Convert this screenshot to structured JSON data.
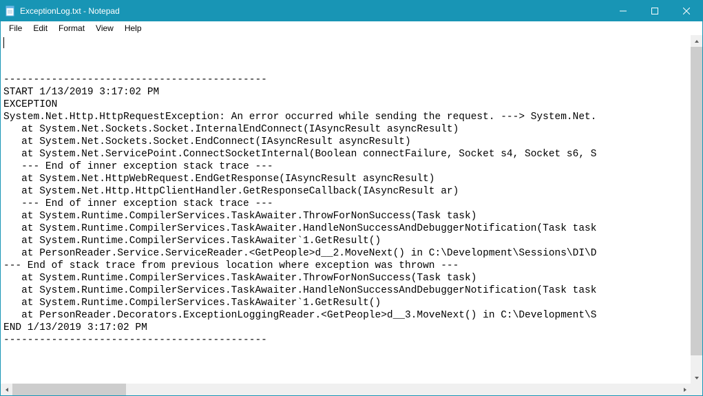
{
  "window": {
    "title": "ExceptionLog.txt - Notepad"
  },
  "menu": {
    "file": "File",
    "edit": "Edit",
    "format": "Format",
    "view": "View",
    "help": "Help"
  },
  "content": {
    "lines": [
      "--------------------------------------------",
      "START 1/13/2019 3:17:02 PM",
      "EXCEPTION",
      "System.Net.Http.HttpRequestException: An error occurred while sending the request. ---> System.Net.",
      "   at System.Net.Sockets.Socket.InternalEndConnect(IAsyncResult asyncResult)",
      "   at System.Net.Sockets.Socket.EndConnect(IAsyncResult asyncResult)",
      "   at System.Net.ServicePoint.ConnectSocketInternal(Boolean connectFailure, Socket s4, Socket s6, S",
      "   --- End of inner exception stack trace ---",
      "   at System.Net.HttpWebRequest.EndGetResponse(IAsyncResult asyncResult)",
      "   at System.Net.Http.HttpClientHandler.GetResponseCallback(IAsyncResult ar)",
      "   --- End of inner exception stack trace ---",
      "   at System.Runtime.CompilerServices.TaskAwaiter.ThrowForNonSuccess(Task task)",
      "   at System.Runtime.CompilerServices.TaskAwaiter.HandleNonSuccessAndDebuggerNotification(Task task",
      "   at System.Runtime.CompilerServices.TaskAwaiter`1.GetResult()",
      "   at PersonReader.Service.ServiceReader.<GetPeople>d__2.MoveNext() in C:\\Development\\Sessions\\DI\\D",
      "--- End of stack trace from previous location where exception was thrown ---",
      "   at System.Runtime.CompilerServices.TaskAwaiter.ThrowForNonSuccess(Task task)",
      "   at System.Runtime.CompilerServices.TaskAwaiter.HandleNonSuccessAndDebuggerNotification(Task task",
      "   at System.Runtime.CompilerServices.TaskAwaiter`1.GetResult()",
      "   at PersonReader.Decorators.ExceptionLoggingReader.<GetPeople>d__3.MoveNext() in C:\\Development\\S",
      "END 1/13/2019 3:17:02 PM",
      "--------------------------------------------"
    ]
  },
  "scroll": {
    "v_thumb_top": 0,
    "v_thumb_height_pct": 95,
    "h_thumb_left": 0,
    "h_thumb_width_pct": 17
  }
}
